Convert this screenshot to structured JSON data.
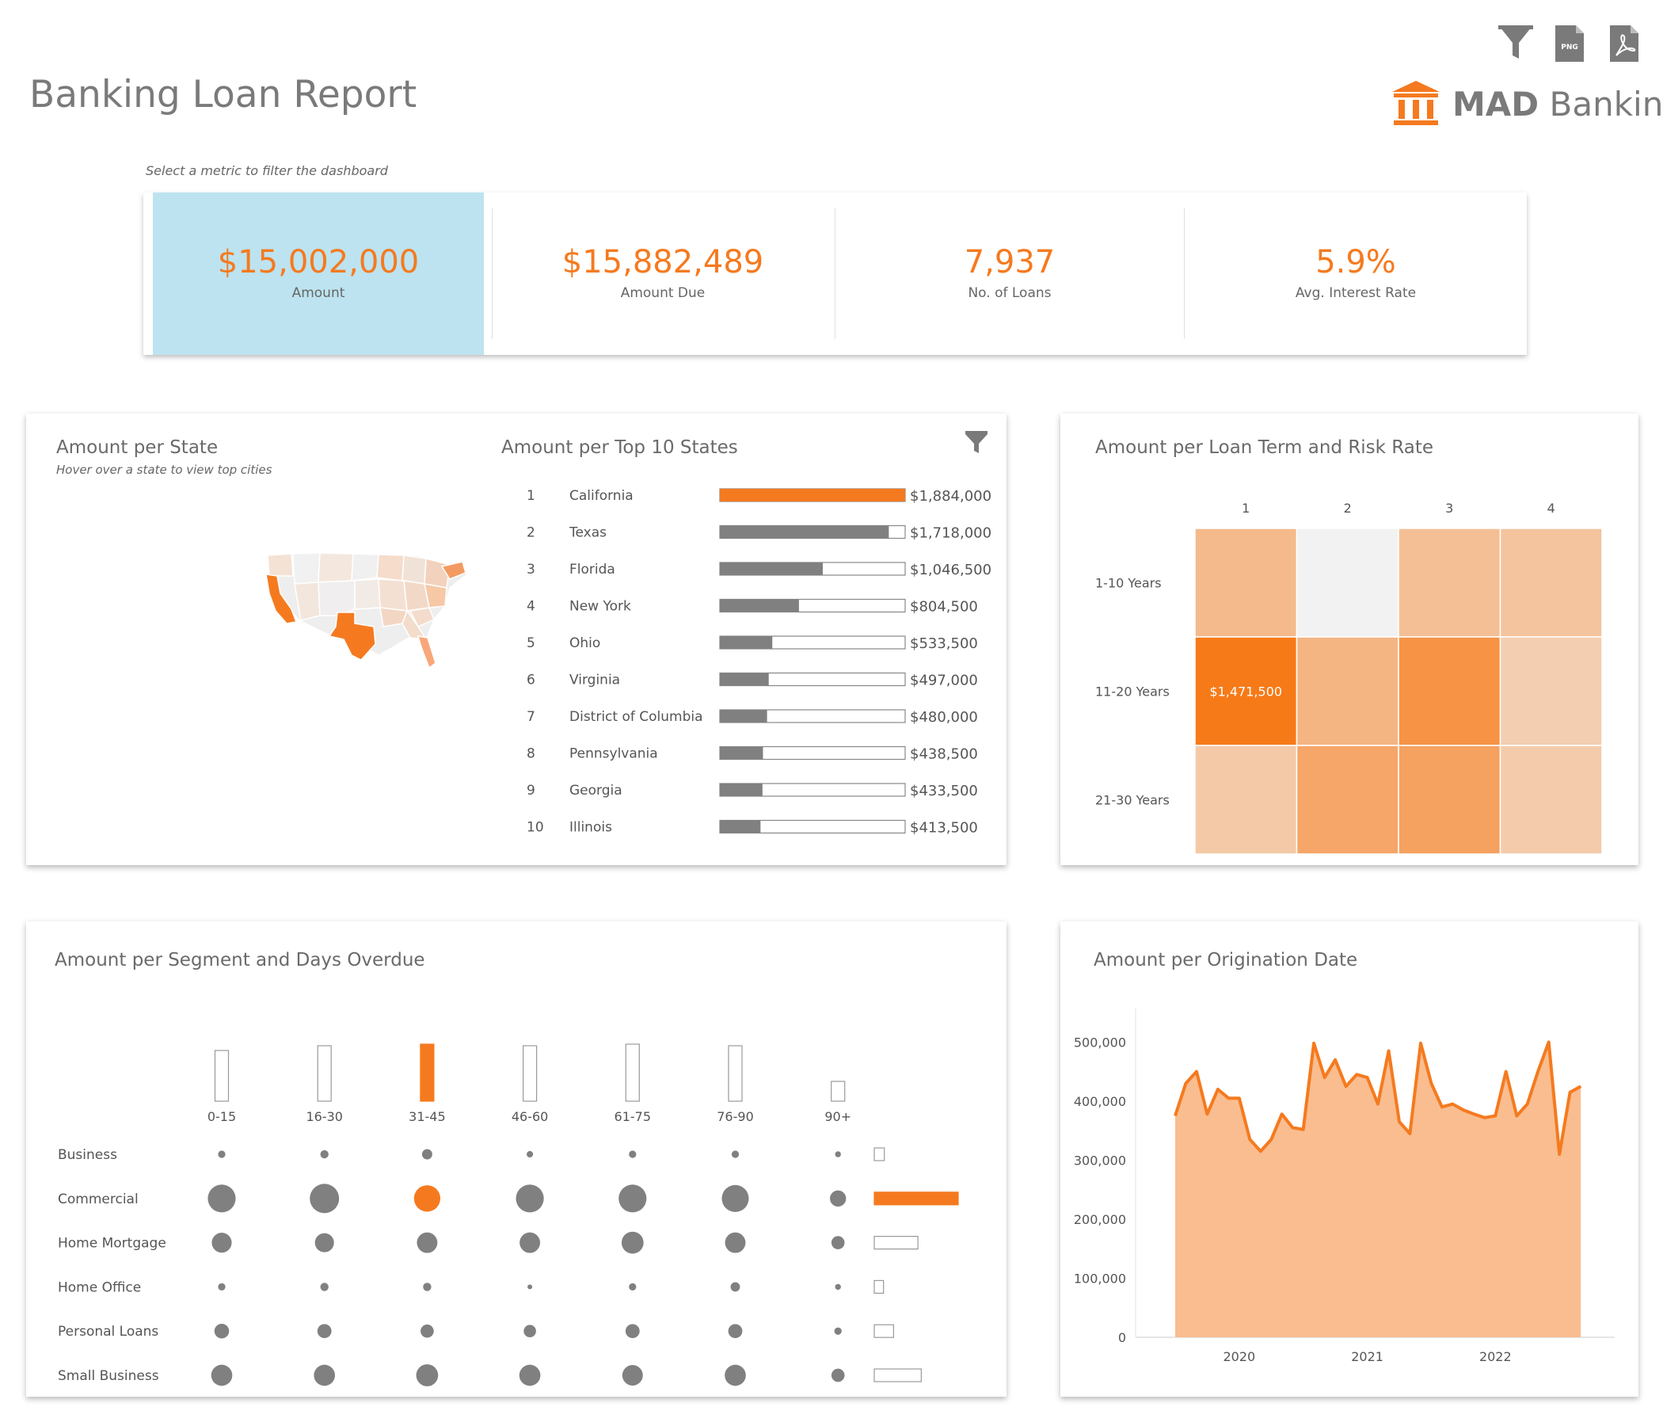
{
  "header": {
    "title": "Banking Loan Report",
    "brand_bold": "MAD",
    "brand_rest": "Banking",
    "filter_hint": "Select a metric to filter the dashboard",
    "toolbar": {
      "png_label": "PNG"
    }
  },
  "colors": {
    "accent": "#f57a1f",
    "gray_bar": "#808080",
    "selected_bg": "#bde3f0",
    "area": "#f9b98a"
  },
  "kpis": [
    {
      "value": "$15,002,000",
      "label": "Amount",
      "selected": true
    },
    {
      "value": "$15,882,489",
      "label": "Amount Due",
      "selected": false
    },
    {
      "value": "7,937",
      "label": "No. of Loans",
      "selected": false
    },
    {
      "value": "5.9%",
      "label": "Avg. Interest Rate",
      "selected": false
    }
  ],
  "state_panel": {
    "title": "Amount per State",
    "subtitle": "Hover over a state to view top cities",
    "top10_title": "Amount per Top 10 States"
  },
  "heatmap_panel": {
    "title": "Amount per Loan Term and Risk Rate"
  },
  "segment_panel": {
    "title": "Amount per Segment and Days Overdue"
  },
  "date_panel": {
    "title": "Amount per Origination Date"
  },
  "chart_data": [
    {
      "type": "bar",
      "title": "Amount per Top 10 States",
      "ranks": [
        "1",
        "2",
        "3",
        "4",
        "5",
        "6",
        "7",
        "8",
        "9",
        "10"
      ],
      "categories": [
        "California",
        "Texas",
        "Florida",
        "New York",
        "Ohio",
        "Virginia",
        "District of Columbia",
        "Pennsylvania",
        "Georgia",
        "Illinois"
      ],
      "values": [
        1884000,
        1718000,
        1046500,
        804500,
        533500,
        497000,
        480000,
        438500,
        433500,
        413500
      ],
      "value_labels": [
        "$1,884,000",
        "$1,718,000",
        "$1,046,500",
        "$804,500",
        "$533,500",
        "$497,000",
        "$480,000",
        "$438,500",
        "$433,500",
        "$413,500"
      ],
      "highlight_index": 0
    },
    {
      "type": "heatmap",
      "title": "Amount per Loan Term and Risk Rate",
      "columns": [
        "1",
        "2",
        "3",
        "4"
      ],
      "rows": [
        "1-10 Years",
        "11-20 Years",
        "21-30 Years"
      ],
      "intensity": [
        [
          0.35,
          0.0,
          0.3,
          0.25
        ],
        [
          1.0,
          0.4,
          0.75,
          0.15
        ],
        [
          0.2,
          0.55,
          0.6,
          0.18
        ]
      ],
      "cell_labels": [
        [
          "",
          "",
          "",
          ""
        ],
        [
          "$1,471,500",
          "",
          "",
          ""
        ],
        [
          "",
          "",
          "",
          ""
        ]
      ]
    },
    {
      "type": "scatter",
      "title": "Amount per Segment and Days Overdue",
      "columns": [
        "0-15",
        "16-30",
        "31-45",
        "46-60",
        "61-75",
        "76-90",
        "90+"
      ],
      "column_totals": [
        0.64,
        0.7,
        0.72,
        0.7,
        0.72,
        0.7,
        0.25
      ],
      "rows": [
        "Business",
        "Commercial",
        "Home Mortgage",
        "Home Office",
        "Personal Loans",
        "Small Business"
      ],
      "row_totals": [
        0.12,
        1.0,
        0.52,
        0.11,
        0.23,
        0.56
      ],
      "bubble_sizes": [
        [
          0.25,
          0.28,
          0.35,
          0.22,
          0.25,
          0.25,
          0.2
        ],
        [
          0.95,
          1.0,
          0.9,
          0.95,
          0.95,
          0.92,
          0.55
        ],
        [
          0.68,
          0.65,
          0.7,
          0.7,
          0.75,
          0.7,
          0.45
        ],
        [
          0.25,
          0.28,
          0.28,
          0.15,
          0.25,
          0.32,
          0.2
        ],
        [
          0.5,
          0.48,
          0.45,
          0.42,
          0.48,
          0.48,
          0.25
        ],
        [
          0.72,
          0.72,
          0.75,
          0.72,
          0.7,
          0.72,
          0.45
        ]
      ],
      "highlight": {
        "row": 1,
        "col": 2
      }
    },
    {
      "type": "area",
      "title": "Amount per Origination Date",
      "ylim": [
        0,
        530000
      ],
      "yticks": [
        0,
        100000,
        200000,
        300000,
        400000,
        500000
      ],
      "ytick_labels": [
        "0",
        "100,000",
        "200,000",
        "300,000",
        "400,000",
        "500,000"
      ],
      "xlim": [
        2019.5,
        2022.7
      ],
      "xticks": [
        2020,
        2021,
        2022
      ],
      "xtick_labels": [
        "2020",
        "2021",
        "2022"
      ],
      "x": [
        2019.5,
        2019.583,
        2019.667,
        2019.75,
        2019.833,
        2019.917,
        2020.0,
        2020.083,
        2020.167,
        2020.25,
        2020.333,
        2020.417,
        2020.5,
        2020.583,
        2020.667,
        2020.75,
        2020.833,
        2020.917,
        2021.0,
        2021.083,
        2021.167,
        2021.25,
        2021.333,
        2021.417,
        2021.5,
        2021.583,
        2021.667,
        2021.75,
        2021.833,
        2021.917,
        2022.0,
        2022.083,
        2022.167,
        2022.25,
        2022.333,
        2022.417,
        2022.5,
        2022.583,
        2022.667
      ],
      "y": [
        375000,
        430000,
        450000,
        378000,
        420000,
        405000,
        405000,
        335000,
        315000,
        335000,
        378000,
        355000,
        352000,
        498000,
        440000,
        470000,
        425000,
        445000,
        440000,
        395000,
        485000,
        365000,
        345000,
        498000,
        430000,
        390000,
        395000,
        385000,
        378000,
        372000,
        375000,
        450000,
        375000,
        395000,
        450000,
        500000,
        310000,
        415000,
        425000
      ]
    }
  ]
}
